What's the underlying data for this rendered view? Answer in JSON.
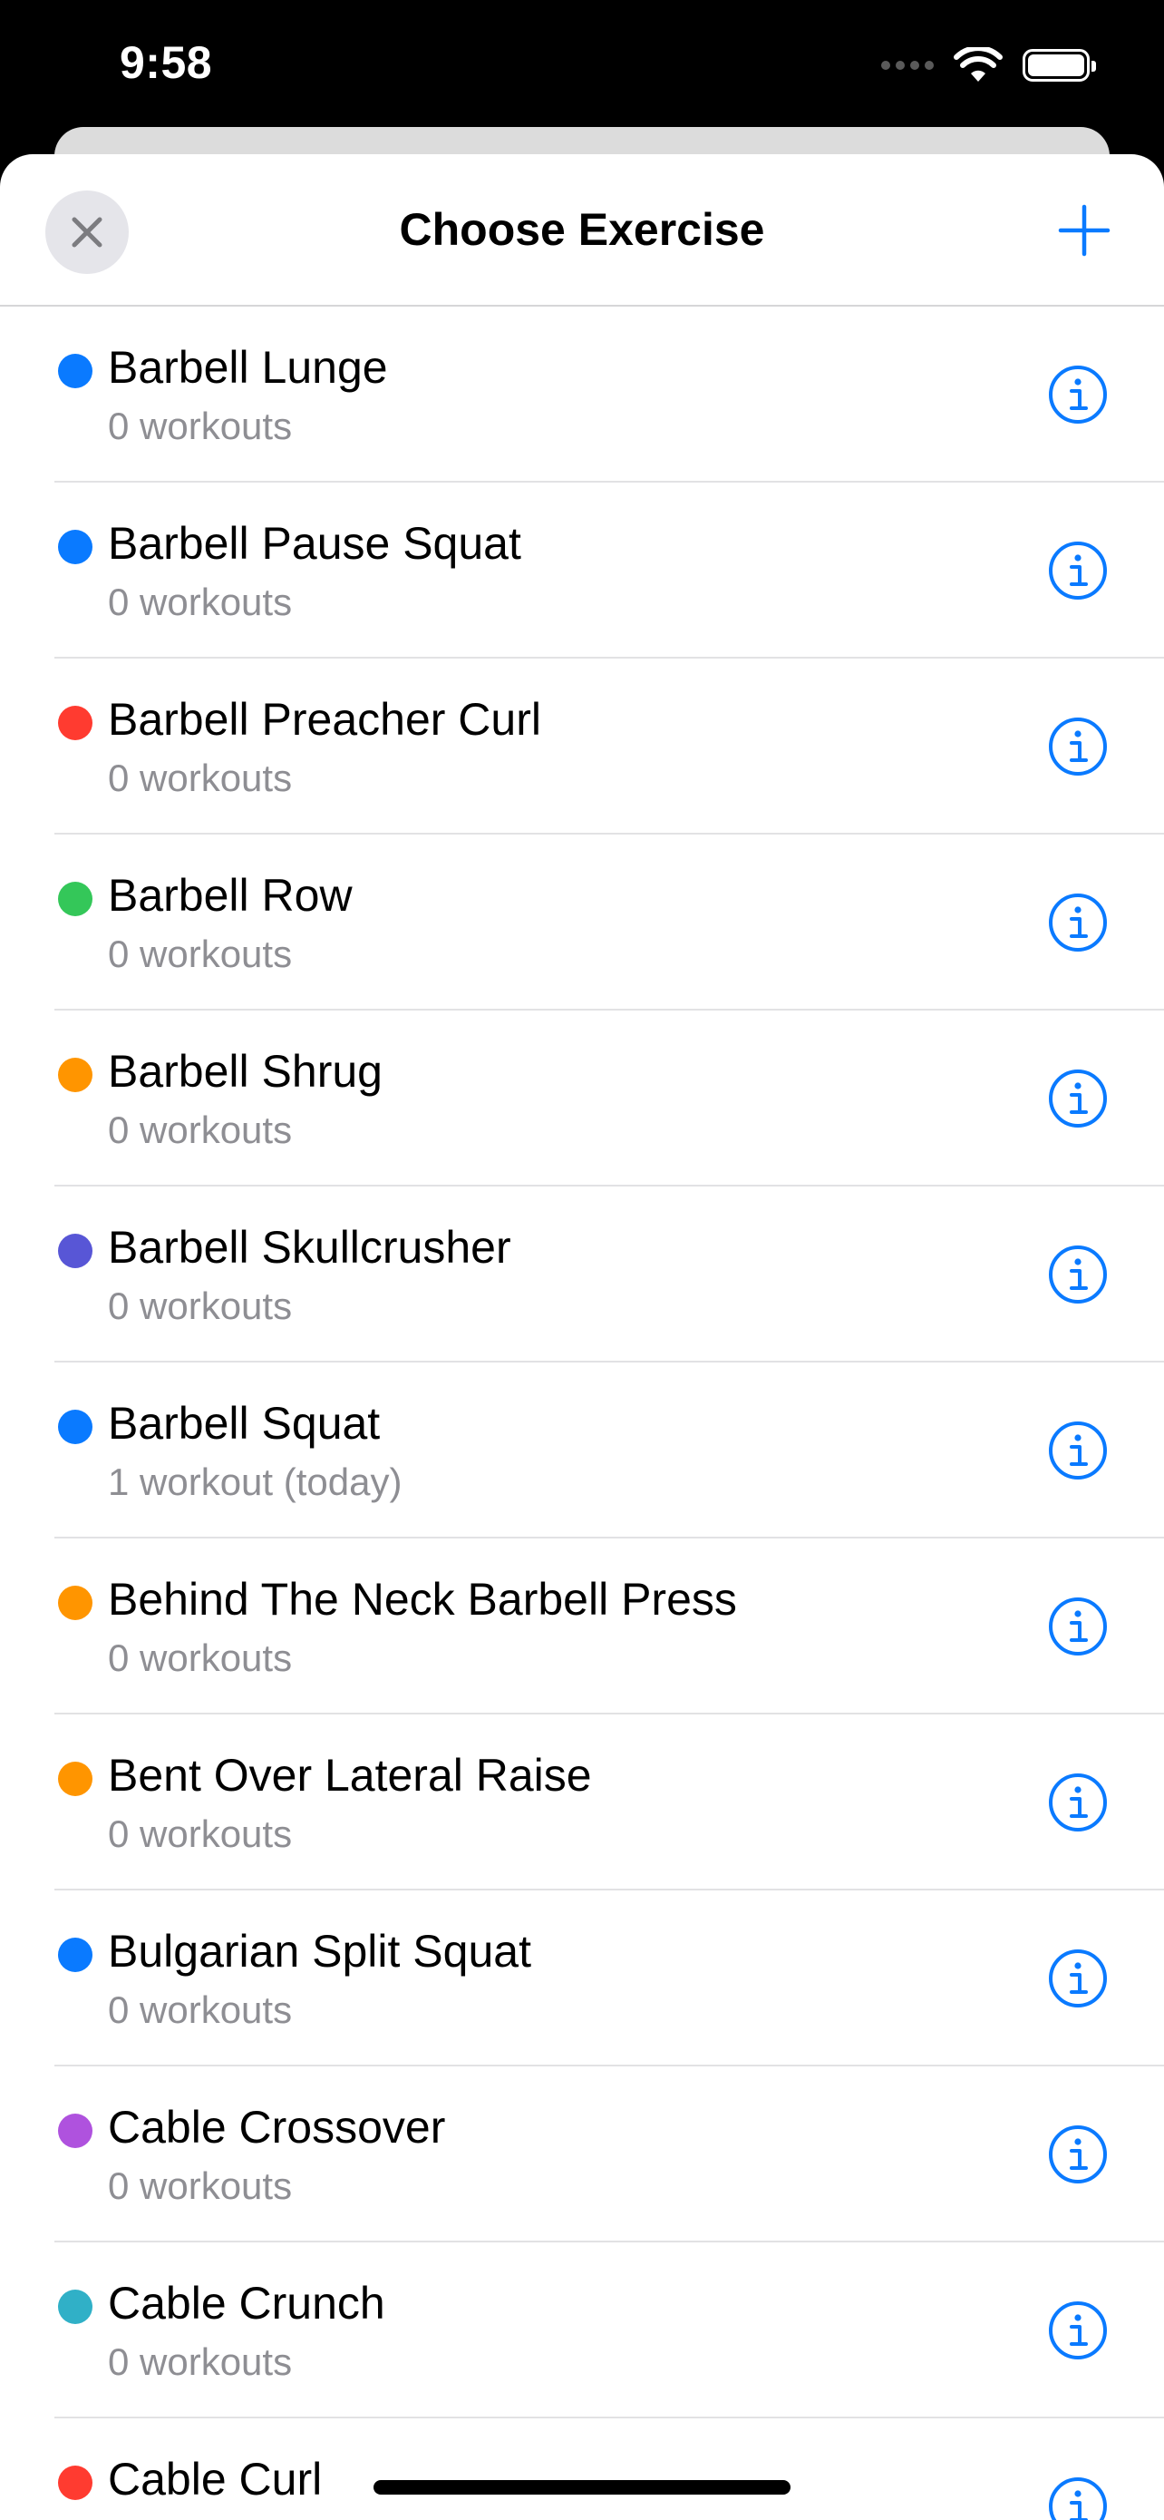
{
  "status_bar": {
    "time": "9:58"
  },
  "nav": {
    "title": "Choose Exercise",
    "close_icon": "xmark-icon",
    "add_icon": "plus-icon"
  },
  "colors": {
    "accent": "#0a7aff",
    "close_bg": "#e5e5ea",
    "secondary_text": "#8e8e93"
  },
  "exercises": [
    {
      "name": "Barbell Lunge",
      "subtitle": "0 workouts",
      "color": "#0a7aff"
    },
    {
      "name": "Barbell Pause Squat",
      "subtitle": "0 workouts",
      "color": "#0a7aff"
    },
    {
      "name": "Barbell Preacher Curl",
      "subtitle": "0 workouts",
      "color": "#ff3b30"
    },
    {
      "name": "Barbell Row",
      "subtitle": "0 workouts",
      "color": "#34c759"
    },
    {
      "name": "Barbell Shrug",
      "subtitle": "0 workouts",
      "color": "#ff9500"
    },
    {
      "name": "Barbell Skullcrusher",
      "subtitle": "0 workouts",
      "color": "#5856d6"
    },
    {
      "name": "Barbell Squat",
      "subtitle": "1 workout (today)",
      "color": "#0a7aff"
    },
    {
      "name": "Behind The Neck Barbell Press",
      "subtitle": "0 workouts",
      "color": "#ff9500"
    },
    {
      "name": "Bent Over Lateral Raise",
      "subtitle": "0 workouts",
      "color": "#ff9500"
    },
    {
      "name": "Bulgarian Split Squat",
      "subtitle": "0 workouts",
      "color": "#0a7aff"
    },
    {
      "name": "Cable Crossover",
      "subtitle": "0 workouts",
      "color": "#af52de"
    },
    {
      "name": "Cable Crunch",
      "subtitle": "0 workouts",
      "color": "#30b0c7"
    },
    {
      "name": "Cable Curl",
      "subtitle": "",
      "color": "#ff3b30"
    }
  ]
}
